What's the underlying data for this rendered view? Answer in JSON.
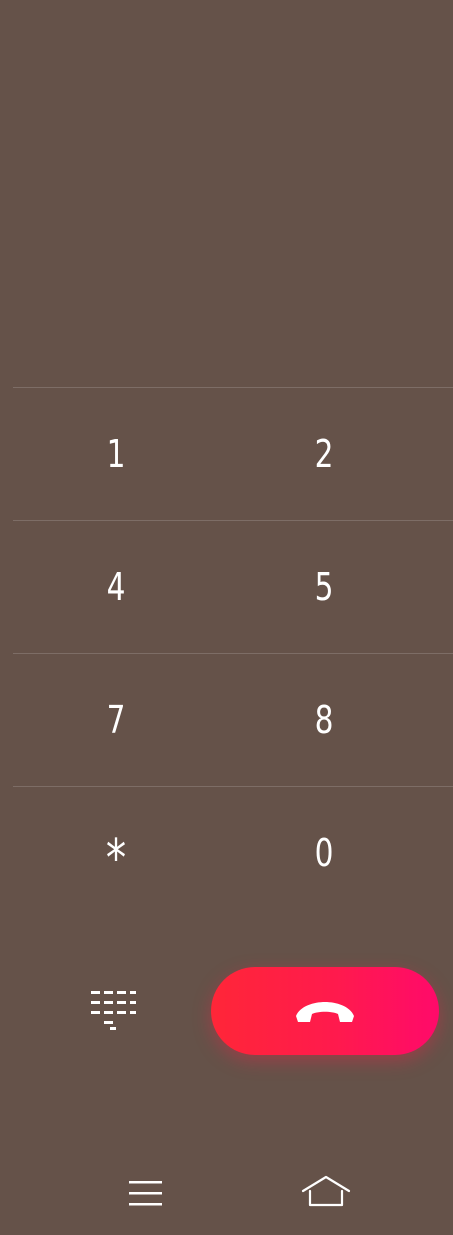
{
  "keypad": {
    "rows": [
      {
        "left": "1",
        "right": "2"
      },
      {
        "left": "4",
        "right": "5"
      },
      {
        "left": "7",
        "right": "8"
      },
      {
        "left": "*",
        "right": "0"
      }
    ]
  },
  "actions": {
    "dialpad_icon": "dialpad-icon",
    "end_call_icon": "end-call-icon",
    "end_call_color": "#ff1f48"
  },
  "navigation": {
    "menu_icon": "menu-icon",
    "home_icon": "home-icon"
  },
  "colors": {
    "background": "#655249",
    "divider": "rgba(255,255,255,0.16)",
    "text": "#ffffff"
  }
}
